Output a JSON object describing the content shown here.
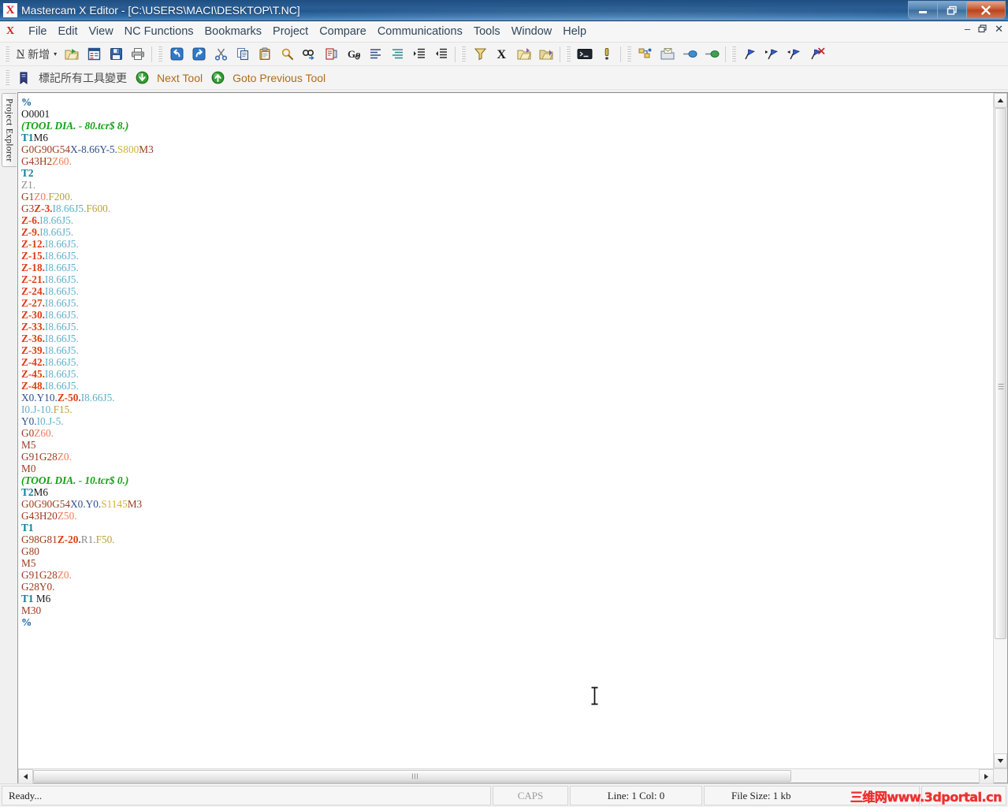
{
  "titlebar": {
    "app_icon": "mastercam-x-logo",
    "title": "Mastercam X Editor - [C:\\USERS\\MACI\\DESKTOP\\T.NC]",
    "minimize_label": "minimize-icon",
    "restore_label": "restore-icon",
    "close_label": "close-icon"
  },
  "menubar": {
    "logo": "X",
    "items": [
      {
        "label": "File"
      },
      {
        "label": "Edit"
      },
      {
        "label": "View"
      },
      {
        "label": "NC Functions"
      },
      {
        "label": "Bookmarks"
      },
      {
        "label": "Project"
      },
      {
        "label": "Compare"
      },
      {
        "label": "Communications"
      },
      {
        "label": "Tools"
      },
      {
        "label": "Window"
      },
      {
        "label": "Help"
      }
    ],
    "mdi": {
      "minimize": "–",
      "restore": "❐",
      "close": "✕"
    }
  },
  "toolbar1": {
    "new_letter": "N",
    "new_label": "新增",
    "dropdown_caret": "▾",
    "icons": [
      {
        "name": "open-file-icon"
      },
      {
        "name": "file-list-icon"
      },
      {
        "name": "save-icon"
      },
      {
        "name": "print-icon"
      },
      {
        "name": "undo-icon"
      },
      {
        "name": "redo-icon"
      },
      {
        "name": "cut-icon"
      },
      {
        "name": "copy-icon"
      },
      {
        "name": "paste-icon"
      },
      {
        "name": "find-icon"
      },
      {
        "name": "find-next-icon"
      },
      {
        "name": "replace-icon"
      },
      {
        "name": "goto-line-icon"
      },
      {
        "name": "align-left-icon"
      },
      {
        "name": "align-indent-icon"
      },
      {
        "name": "indent-increase-icon"
      },
      {
        "name": "indent-decrease-icon"
      },
      {
        "name": "filter-icon"
      },
      {
        "name": "x-transform-icon"
      },
      {
        "name": "open-folder-icon"
      },
      {
        "name": "open-folder-alt-icon"
      },
      {
        "name": "terminal-icon"
      },
      {
        "name": "alert-icon"
      },
      {
        "name": "config-icon"
      },
      {
        "name": "send-file-icon"
      },
      {
        "name": "connect-blue-icon"
      },
      {
        "name": "connect-green-icon"
      },
      {
        "name": "bookmark-add-icon"
      },
      {
        "name": "bookmark-next-icon"
      },
      {
        "name": "bookmark-prev-icon"
      },
      {
        "name": "bookmark-clear-icon"
      }
    ]
  },
  "toolbar2": {
    "mark_tool_icon": "bookmark-tool-icon",
    "mark_all_label": "標記所有工具變更",
    "next_tool_icon": "arrow-down-circle-icon",
    "next_tool_label": "Next Tool",
    "prev_tool_icon": "arrow-up-circle-icon",
    "prev_tool_label": "Goto Previous Tool"
  },
  "sidebar": {
    "tab_label": "Project Explorer"
  },
  "editor": {
    "cursor": "text-ibeam-cursor",
    "lines": [
      [
        {
          "t": "%",
          "c": "c-pct"
        }
      ],
      [
        {
          "t": "O0001",
          "c": "c-prog"
        }
      ],
      [
        {
          "t": "(TOOL DIA. - 80.tcr$ 8.)",
          "c": "c-cmt"
        }
      ],
      [
        {
          "t": "T1",
          "c": "c-tool"
        },
        {
          "t": "M6",
          "c": "c-prog"
        }
      ],
      [
        {
          "t": "G0G90G54",
          "c": "c-g"
        },
        {
          "t": "X-8.66Y-5.",
          "c": "c-xy"
        },
        {
          "t": "S800",
          "c": "c-s"
        },
        {
          "t": "M3",
          "c": "c-m"
        }
      ],
      [
        {
          "t": "G43H2",
          "c": "c-g"
        },
        {
          "t": "Z60.",
          "c": "c-zs"
        }
      ],
      [
        {
          "t": "T2",
          "c": "c-tool"
        }
      ],
      [
        {
          "t": "Z1.",
          "c": "c-plain"
        }
      ],
      [
        {
          "t": "G1",
          "c": "c-g"
        },
        {
          "t": "Z0.",
          "c": "c-zs"
        },
        {
          "t": "F200.",
          "c": "c-f"
        }
      ],
      [
        {
          "t": "G3",
          "c": "c-g"
        },
        {
          "t": "Z-3.",
          "c": "c-z"
        },
        {
          "t": "I8.66J5.",
          "c": "c-ij"
        },
        {
          "t": "F600.",
          "c": "c-f"
        }
      ],
      [
        {
          "t": "Z-6.",
          "c": "c-z"
        },
        {
          "t": "I8.66J5.",
          "c": "c-ij"
        }
      ],
      [
        {
          "t": "Z-9.",
          "c": "c-z"
        },
        {
          "t": "I8.66J5.",
          "c": "c-ij"
        }
      ],
      [
        {
          "t": "Z-12.",
          "c": "c-z"
        },
        {
          "t": "I8.66J5.",
          "c": "c-ij"
        }
      ],
      [
        {
          "t": "Z-15.",
          "c": "c-z"
        },
        {
          "t": "I8.66J5.",
          "c": "c-ij"
        }
      ],
      [
        {
          "t": "Z-18.",
          "c": "c-z"
        },
        {
          "t": "I8.66J5.",
          "c": "c-ij"
        }
      ],
      [
        {
          "t": "Z-21.",
          "c": "c-z"
        },
        {
          "t": "I8.66J5.",
          "c": "c-ij"
        }
      ],
      [
        {
          "t": "Z-24.",
          "c": "c-z"
        },
        {
          "t": "I8.66J5.",
          "c": "c-ij"
        }
      ],
      [
        {
          "t": "Z-27.",
          "c": "c-z"
        },
        {
          "t": "I8.66J5.",
          "c": "c-ij"
        }
      ],
      [
        {
          "t": "Z-30.",
          "c": "c-z"
        },
        {
          "t": "I8.66J5.",
          "c": "c-ij"
        }
      ],
      [
        {
          "t": "Z-33.",
          "c": "c-z"
        },
        {
          "t": "I8.66J5.",
          "c": "c-ij"
        }
      ],
      [
        {
          "t": "Z-36.",
          "c": "c-z"
        },
        {
          "t": "I8.66J5.",
          "c": "c-ij"
        }
      ],
      [
        {
          "t": "Z-39.",
          "c": "c-z"
        },
        {
          "t": "I8.66J5.",
          "c": "c-ij"
        }
      ],
      [
        {
          "t": "Z-42.",
          "c": "c-z"
        },
        {
          "t": "I8.66J5.",
          "c": "c-ij"
        }
      ],
      [
        {
          "t": "Z-45.",
          "c": "c-z"
        },
        {
          "t": "I8.66J5.",
          "c": "c-ij"
        }
      ],
      [
        {
          "t": "Z-48.",
          "c": "c-z"
        },
        {
          "t": "I8.66J5.",
          "c": "c-ij"
        }
      ],
      [
        {
          "t": "X0.Y10.",
          "c": "c-xy"
        },
        {
          "t": "Z-50.",
          "c": "c-z"
        },
        {
          "t": "I8.66J5.",
          "c": "c-ij"
        }
      ],
      [
        {
          "t": "I0.J-10.",
          "c": "c-ij"
        },
        {
          "t": "F15.",
          "c": "c-f"
        }
      ],
      [
        {
          "t": "Y0.",
          "c": "c-xy"
        },
        {
          "t": "I0.J-5.",
          "c": "c-ij"
        }
      ],
      [
        {
          "t": "G0",
          "c": "c-g"
        },
        {
          "t": "Z60.",
          "c": "c-zs"
        }
      ],
      [
        {
          "t": "M5",
          "c": "c-m"
        }
      ],
      [
        {
          "t": "G91G28",
          "c": "c-g"
        },
        {
          "t": "Z0.",
          "c": "c-zs"
        }
      ],
      [
        {
          "t": "M0",
          "c": "c-m"
        }
      ],
      [
        {
          "t": "(TOOL DIA. - 10.tcr$ 0.)",
          "c": "c-cmt"
        }
      ],
      [
        {
          "t": "T2",
          "c": "c-tool"
        },
        {
          "t": "M6",
          "c": "c-prog"
        }
      ],
      [
        {
          "t": "G0G90G54",
          "c": "c-g"
        },
        {
          "t": "X0.Y0.",
          "c": "c-xy"
        },
        {
          "t": "S1145",
          "c": "c-s"
        },
        {
          "t": "M3",
          "c": "c-m"
        }
      ],
      [
        {
          "t": "G43H20",
          "c": "c-g"
        },
        {
          "t": "Z50.",
          "c": "c-zs"
        }
      ],
      [
        {
          "t": "T1",
          "c": "c-tool"
        }
      ],
      [
        {
          "t": "G98G81",
          "c": "c-g"
        },
        {
          "t": "Z-20.",
          "c": "c-z"
        },
        {
          "t": "R1.",
          "c": "c-r"
        },
        {
          "t": "F50.",
          "c": "c-f"
        }
      ],
      [
        {
          "t": "G80",
          "c": "c-g"
        }
      ],
      [
        {
          "t": "M5",
          "c": "c-m"
        }
      ],
      [
        {
          "t": "G91G28",
          "c": "c-g"
        },
        {
          "t": "Z0.",
          "c": "c-zs"
        }
      ],
      [
        {
          "t": "G28Y0.",
          "c": "c-g"
        }
      ],
      [
        {
          "t": "T1 ",
          "c": "c-tool"
        },
        {
          "t": "M6",
          "c": "c-prog"
        }
      ],
      [
        {
          "t": "M30",
          "c": "c-m"
        }
      ],
      [
        {
          "t": "%",
          "c": "c-pct"
        }
      ]
    ]
  },
  "statusbar": {
    "ready": "Ready...",
    "caps": "CAPS",
    "line_col": "Line:  1  Col:  0",
    "file_size": "File Size: 1 kb",
    "watermark": "三维网www.3dportal.cn"
  },
  "colors": {
    "title_blue": "#2b5e95",
    "accent_red": "#d21f1f",
    "menu_text": "#30465c",
    "comment_green": "#12a012",
    "z_red": "#e03a14",
    "tool_teal": "#0d7f96"
  }
}
